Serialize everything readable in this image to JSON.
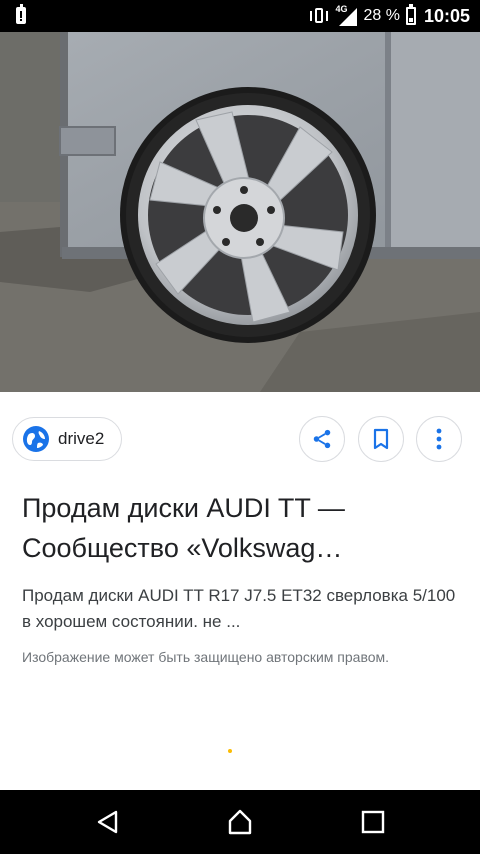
{
  "status_bar": {
    "network": "4G",
    "battery_percent": "28 %",
    "time": "10:05",
    "icons": [
      "battery-alert-icon",
      "vibrate-icon",
      "signal-icon",
      "battery-icon"
    ]
  },
  "image": {
    "description_icon": "wheel-photo"
  },
  "source": {
    "label": "drive2",
    "icon": "globe-icon"
  },
  "actions": {
    "share_icon": "share-icon",
    "save_icon": "bookmark-icon",
    "more_icon": "more-vert-icon"
  },
  "result": {
    "title": "Продам диски AUDI TT — Сообщество «Volkswag…",
    "title_line1": "Продам диски AUDI TT —",
    "title_line2": "Сообщество «Volkswag…",
    "description": "Продам диски AUDI TT R17 J7.5 ET32 сверловка 5/100 в хорошем состоянии. не ...",
    "copyright": "Изображение может быть защищено авторским правом."
  },
  "colors": {
    "accent_blue": "#1a73e8",
    "loading_dot": "#fbbc04",
    "text_primary": "#202124",
    "text_secondary": "#70757a"
  },
  "nav_bar": {
    "icons": [
      "back-icon",
      "home-icon",
      "recents-icon"
    ]
  }
}
